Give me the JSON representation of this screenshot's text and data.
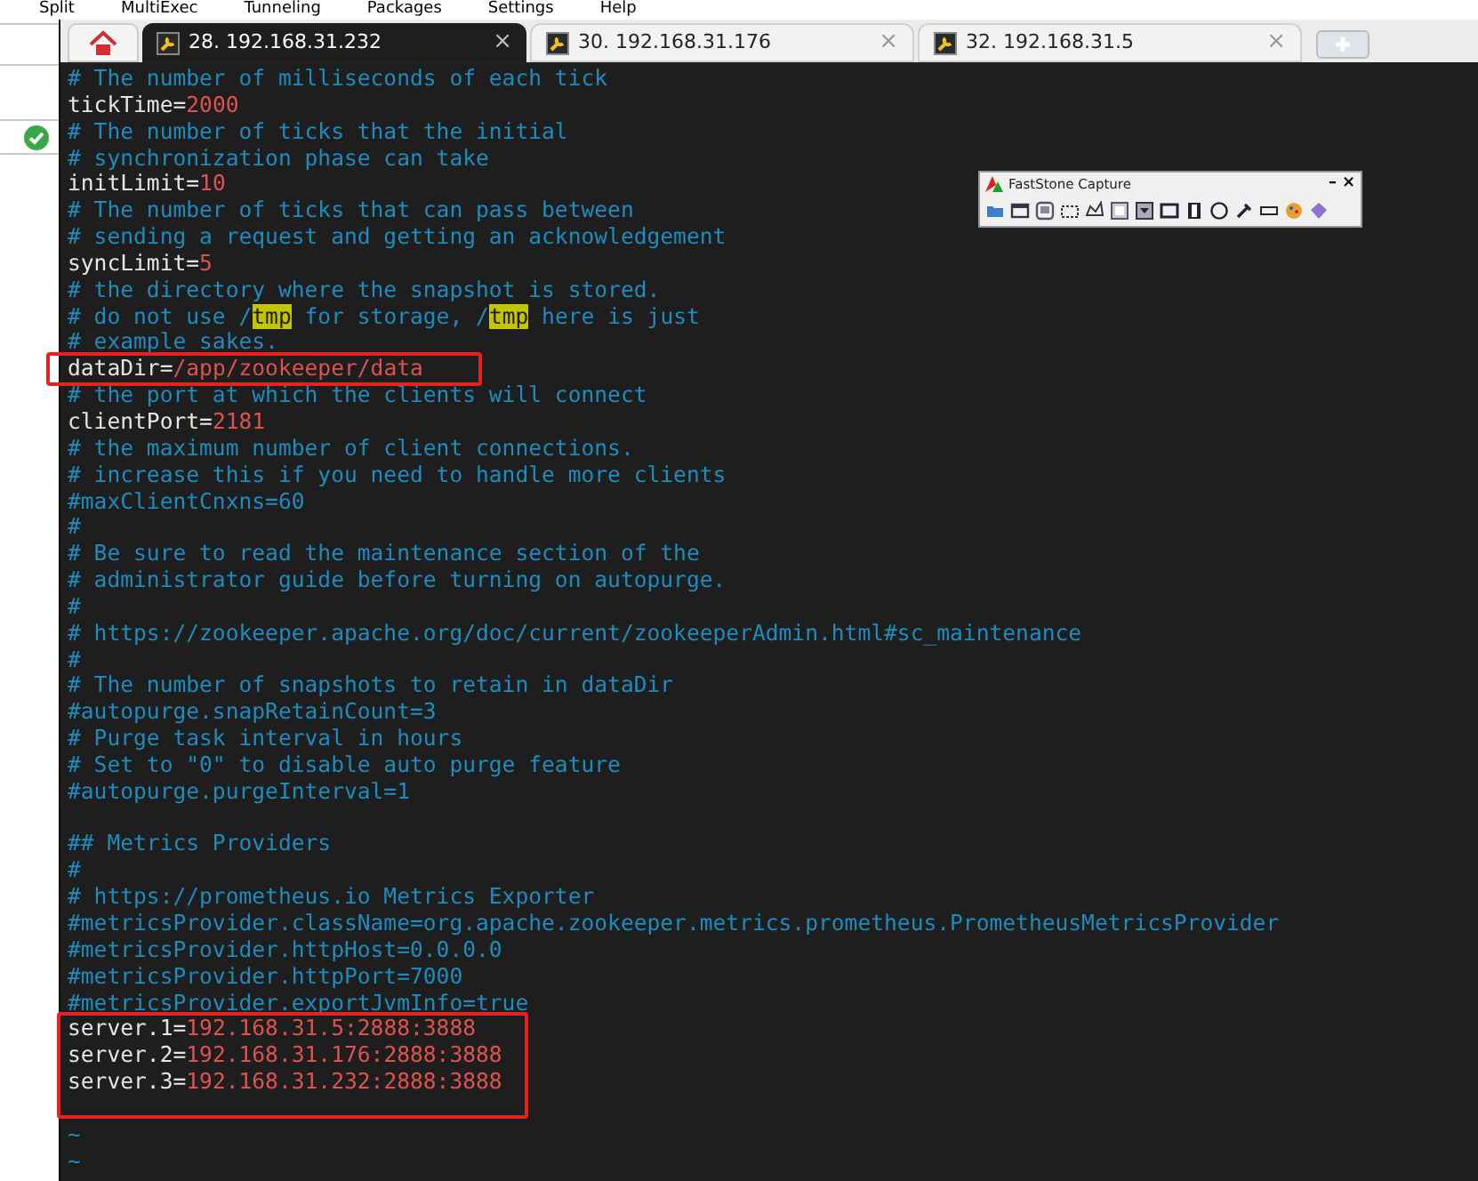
{
  "menu": [
    "Split",
    "MultiExec",
    "Tunneling",
    "Packages",
    "Settings",
    "Help"
  ],
  "tabs": [
    {
      "label": "28. 192.168.31.232",
      "close": "×",
      "selected": true
    },
    {
      "label": "30. 192.168.31.176",
      "close": "×",
      "selected": false
    },
    {
      "label": "32. 192.168.31.5",
      "close": "×",
      "selected": false
    }
  ],
  "capture_toolbar": {
    "title": "FastStone Capture",
    "minimize": "–",
    "close": "×"
  },
  "lines": [
    {
      "kind": "code",
      "segments": [
        {
          "kind": "comment",
          "text": "# The number of milliseconds of each tick"
        }
      ]
    },
    {
      "kind": "code",
      "segments": [
        {
          "kind": "key",
          "text": "tickTime="
        },
        {
          "kind": "value",
          "text": "2000"
        }
      ]
    },
    {
      "kind": "code",
      "segments": [
        {
          "kind": "comment",
          "text": "# The number of ticks that the initial"
        }
      ]
    },
    {
      "kind": "code",
      "segments": [
        {
          "kind": "comment",
          "text": "# synchronization phase can take"
        }
      ]
    },
    {
      "kind": "code",
      "segments": [
        {
          "kind": "key",
          "text": "initLimit="
        },
        {
          "kind": "value",
          "text": "10"
        }
      ]
    },
    {
      "kind": "code",
      "segments": [
        {
          "kind": "comment",
          "text": "# The number of ticks that can pass between"
        }
      ]
    },
    {
      "kind": "code",
      "segments": [
        {
          "kind": "comment",
          "text": "# sending a request and getting an acknowledgement"
        }
      ]
    },
    {
      "kind": "code",
      "segments": [
        {
          "kind": "key",
          "text": "syncLimit="
        },
        {
          "kind": "value",
          "text": "5"
        }
      ]
    },
    {
      "kind": "code",
      "segments": [
        {
          "kind": "comment",
          "text": "# the directory where the snapshot is stored."
        }
      ]
    },
    {
      "kind": "code",
      "segments": [
        {
          "kind": "comment",
          "text": "# do not use /"
        },
        {
          "kind": "highlight",
          "text": "tmp"
        },
        {
          "kind": "comment",
          "text": " for storage, /"
        },
        {
          "kind": "highlight",
          "text": "tmp"
        },
        {
          "kind": "comment",
          "text": " here is just"
        }
      ]
    },
    {
      "kind": "code",
      "segments": [
        {
          "kind": "comment",
          "text": "# example sakes."
        }
      ]
    },
    {
      "kind": "code",
      "segments": [
        {
          "kind": "key",
          "text": "dataDir="
        },
        {
          "kind": "value",
          "text": "/app/zookeeper/data"
        }
      ]
    },
    {
      "kind": "code",
      "segments": [
        {
          "kind": "comment",
          "text": "# the port at which the clients will connect"
        }
      ]
    },
    {
      "kind": "code",
      "segments": [
        {
          "kind": "key",
          "text": "clientPort="
        },
        {
          "kind": "value",
          "text": "2181"
        }
      ]
    },
    {
      "kind": "code",
      "segments": [
        {
          "kind": "comment",
          "text": "# the maximum number of client connections."
        }
      ]
    },
    {
      "kind": "code",
      "segments": [
        {
          "kind": "comment",
          "text": "# increase this if you need to handle more clients"
        }
      ]
    },
    {
      "kind": "code",
      "segments": [
        {
          "kind": "comment",
          "text": "#maxClientCnxns=60"
        }
      ]
    },
    {
      "kind": "code",
      "segments": [
        {
          "kind": "comment",
          "text": "#"
        }
      ]
    },
    {
      "kind": "code",
      "segments": [
        {
          "kind": "comment",
          "text": "# Be sure to read the maintenance section of the"
        }
      ]
    },
    {
      "kind": "code",
      "segments": [
        {
          "kind": "comment",
          "text": "# administrator guide before turning on autopurge."
        }
      ]
    },
    {
      "kind": "code",
      "segments": [
        {
          "kind": "comment",
          "text": "#"
        }
      ]
    },
    {
      "kind": "code",
      "segments": [
        {
          "kind": "comment",
          "text": "# https://zookeeper.apache.org/doc/current/zookeeperAdmin.html#sc_maintenance"
        }
      ]
    },
    {
      "kind": "code",
      "segments": [
        {
          "kind": "comment",
          "text": "#"
        }
      ]
    },
    {
      "kind": "code",
      "segments": [
        {
          "kind": "comment",
          "text": "# The number of snapshots to retain in dataDir"
        }
      ]
    },
    {
      "kind": "code",
      "segments": [
        {
          "kind": "comment",
          "text": "#autopurge.snapRetainCount=3"
        }
      ]
    },
    {
      "kind": "code",
      "segments": [
        {
          "kind": "comment",
          "text": "# Purge task interval in hours"
        }
      ]
    },
    {
      "kind": "code",
      "segments": [
        {
          "kind": "comment",
          "text": "# Set to \"0\" to disable auto purge feature"
        }
      ]
    },
    {
      "kind": "code",
      "segments": [
        {
          "kind": "comment",
          "text": "#autopurge.purgeInterval=1"
        }
      ]
    },
    {
      "kind": "blank"
    },
    {
      "kind": "code",
      "segments": [
        {
          "kind": "comment",
          "text": "## Metrics Providers"
        }
      ]
    },
    {
      "kind": "code",
      "segments": [
        {
          "kind": "comment",
          "text": "#"
        }
      ]
    },
    {
      "kind": "code",
      "segments": [
        {
          "kind": "comment",
          "text": "# https://prometheus.io Metrics Exporter"
        }
      ]
    },
    {
      "kind": "code",
      "segments": [
        {
          "kind": "comment",
          "text": "#metricsProvider.className=org.apache.zookeeper.metrics.prometheus.PrometheusMetricsProvider"
        }
      ]
    },
    {
      "kind": "code",
      "segments": [
        {
          "kind": "comment",
          "text": "#metricsProvider.httpHost=0.0.0.0"
        }
      ]
    },
    {
      "kind": "code",
      "segments": [
        {
          "kind": "comment",
          "text": "#metricsProvider.httpPort=7000"
        }
      ]
    },
    {
      "kind": "code",
      "segments": [
        {
          "kind": "comment",
          "text": "#metricsProvider.exportJvmInfo=true"
        }
      ]
    },
    {
      "kind": "code",
      "segments": [
        {
          "kind": "key",
          "text": "server.1="
        },
        {
          "kind": "value",
          "text": "192.168.31.5:2888:3888"
        }
      ]
    },
    {
      "kind": "code",
      "segments": [
        {
          "kind": "key",
          "text": "server.2="
        },
        {
          "kind": "value",
          "text": "192.168.31.176:2888:3888"
        }
      ]
    },
    {
      "kind": "code",
      "segments": [
        {
          "kind": "key",
          "text": "server.3="
        },
        {
          "kind": "value",
          "text": "192.168.31.232:2888:3888"
        }
      ]
    },
    {
      "kind": "blank"
    },
    {
      "kind": "code",
      "segments": [
        {
          "kind": "tilde",
          "text": "~"
        }
      ]
    },
    {
      "kind": "code",
      "segments": [
        {
          "kind": "tilde",
          "text": "~"
        }
      ]
    }
  ]
}
